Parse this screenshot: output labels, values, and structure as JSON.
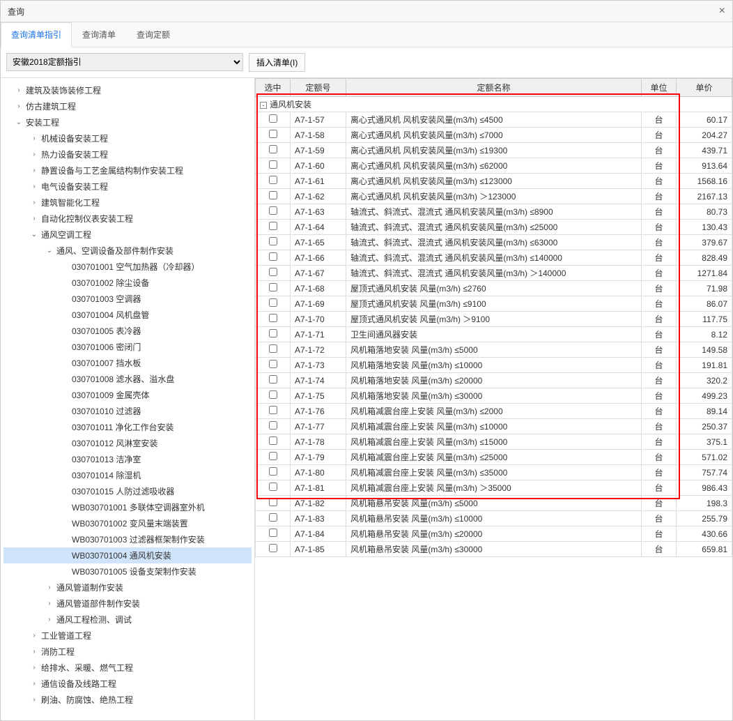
{
  "window": {
    "title": "查询"
  },
  "tabs": [
    {
      "label": "查询清单指引",
      "active": true
    },
    {
      "label": "查询清单",
      "active": false
    },
    {
      "label": "查询定额",
      "active": false
    }
  ],
  "dropdown": {
    "selected": "安徽2018定额指引"
  },
  "buttons": {
    "insert": "插入清单(I)"
  },
  "tree": [
    {
      "indent": 0,
      "arrow": ">",
      "label": "建筑及装饰装修工程"
    },
    {
      "indent": 0,
      "arrow": ">",
      "label": "仿古建筑工程"
    },
    {
      "indent": 0,
      "arrow": "v",
      "label": "安装工程"
    },
    {
      "indent": 1,
      "arrow": ">",
      "label": "机械设备安装工程"
    },
    {
      "indent": 1,
      "arrow": ">",
      "label": "热力设备安装工程"
    },
    {
      "indent": 1,
      "arrow": ">",
      "label": "静置设备与工艺金属结构制作安装工程"
    },
    {
      "indent": 1,
      "arrow": ">",
      "label": "电气设备安装工程"
    },
    {
      "indent": 1,
      "arrow": ">",
      "label": "建筑智能化工程"
    },
    {
      "indent": 1,
      "arrow": ">",
      "label": "自动化控制仪表安装工程"
    },
    {
      "indent": 1,
      "arrow": "v",
      "label": "通风空调工程"
    },
    {
      "indent": 2,
      "arrow": "v",
      "label": "通风、空调设备及部件制作安装"
    },
    {
      "indent": 3,
      "arrow": "",
      "label": "030701001  空气加热器（冷却器）"
    },
    {
      "indent": 3,
      "arrow": "",
      "label": "030701002  除尘设备"
    },
    {
      "indent": 3,
      "arrow": "",
      "label": "030701003  空调器"
    },
    {
      "indent": 3,
      "arrow": "",
      "label": "030701004  风机盘管"
    },
    {
      "indent": 3,
      "arrow": "",
      "label": "030701005  表冷器"
    },
    {
      "indent": 3,
      "arrow": "",
      "label": "030701006  密闭门"
    },
    {
      "indent": 3,
      "arrow": "",
      "label": "030701007  挡水板"
    },
    {
      "indent": 3,
      "arrow": "",
      "label": "030701008  滤水器、溢水盘"
    },
    {
      "indent": 3,
      "arrow": "",
      "label": "030701009  金属壳体"
    },
    {
      "indent": 3,
      "arrow": "",
      "label": "030701010  过滤器"
    },
    {
      "indent": 3,
      "arrow": "",
      "label": "030701011  净化工作台安装"
    },
    {
      "indent": 3,
      "arrow": "",
      "label": "030701012  风淋室安装"
    },
    {
      "indent": 3,
      "arrow": "",
      "label": "030701013  洁净室"
    },
    {
      "indent": 3,
      "arrow": "",
      "label": "030701014  除湿机"
    },
    {
      "indent": 3,
      "arrow": "",
      "label": "030701015  人防过滤吸收器"
    },
    {
      "indent": 3,
      "arrow": "",
      "label": "WB030701001  多联体空调器室外机"
    },
    {
      "indent": 3,
      "arrow": "",
      "label": "WB030701002  变风量末端装置"
    },
    {
      "indent": 3,
      "arrow": "",
      "label": "WB030701003  过滤器框架制作安装"
    },
    {
      "indent": 3,
      "arrow": "",
      "label": "WB030701004  通风机安装",
      "selected": true
    },
    {
      "indent": 3,
      "arrow": "",
      "label": "WB030701005  设备支架制作安装"
    },
    {
      "indent": 2,
      "arrow": ">",
      "label": "通风管道制作安装"
    },
    {
      "indent": 2,
      "arrow": ">",
      "label": "通风管道部件制作安装"
    },
    {
      "indent": 2,
      "arrow": ">",
      "label": "通风工程检测、调试"
    },
    {
      "indent": 1,
      "arrow": ">",
      "label": "工业管道工程"
    },
    {
      "indent": 1,
      "arrow": ">",
      "label": "消防工程"
    },
    {
      "indent": 1,
      "arrow": ">",
      "label": "给排水、采暖、燃气工程"
    },
    {
      "indent": 1,
      "arrow": ">",
      "label": "通信设备及线路工程"
    },
    {
      "indent": 1,
      "arrow": ">",
      "label": "刷油、防腐蚀、绝热工程"
    }
  ],
  "table": {
    "headers": {
      "sel": "选中",
      "code": "定额号",
      "name": "定额名称",
      "unit": "单位",
      "price": "单价"
    },
    "group": "通风机安装",
    "rows": [
      {
        "code": "A7-1-57",
        "name": "离心式通风机 风机安装风量(m3/h) ≤4500",
        "unit": "台",
        "price": "60.17"
      },
      {
        "code": "A7-1-58",
        "name": "离心式通风机 风机安装风量(m3/h) ≤7000",
        "unit": "台",
        "price": "204.27"
      },
      {
        "code": "A7-1-59",
        "name": "离心式通风机 风机安装风量(m3/h) ≤19300",
        "unit": "台",
        "price": "439.71"
      },
      {
        "code": "A7-1-60",
        "name": "离心式通风机 风机安装风量(m3/h) ≤62000",
        "unit": "台",
        "price": "913.64"
      },
      {
        "code": "A7-1-61",
        "name": "离心式通风机 风机安装风量(m3/h) ≤123000",
        "unit": "台",
        "price": "1568.16"
      },
      {
        "code": "A7-1-62",
        "name": "离心式通风机 风机安装风量(m3/h) ＞123000",
        "unit": "台",
        "price": "2167.13"
      },
      {
        "code": "A7-1-63",
        "name": "轴流式、斜流式、混流式 通风机安装风量(m3/h) ≤8900",
        "unit": "台",
        "price": "80.73"
      },
      {
        "code": "A7-1-64",
        "name": "轴流式、斜流式、混流式 通风机安装风量(m3/h) ≤25000",
        "unit": "台",
        "price": "130.43"
      },
      {
        "code": "A7-1-65",
        "name": "轴流式、斜流式、混流式 通风机安装风量(m3/h) ≤63000",
        "unit": "台",
        "price": "379.67"
      },
      {
        "code": "A7-1-66",
        "name": "轴流式、斜流式、混流式 通风机安装风量(m3/h) ≤140000",
        "unit": "台",
        "price": "828.49"
      },
      {
        "code": "A7-1-67",
        "name": "轴流式、斜流式、混流式 通风机安装风量(m3/h) ＞140000",
        "unit": "台",
        "price": "1271.84"
      },
      {
        "code": "A7-1-68",
        "name": "屋顶式通风机安装 风量(m3/h) ≤2760",
        "unit": "台",
        "price": "71.98"
      },
      {
        "code": "A7-1-69",
        "name": "屋顶式通风机安装 风量(m3/h) ≤9100",
        "unit": "台",
        "price": "86.07"
      },
      {
        "code": "A7-1-70",
        "name": "屋顶式通风机安装 风量(m3/h) ＞9100",
        "unit": "台",
        "price": "117.75"
      },
      {
        "code": "A7-1-71",
        "name": "卫生间通风器安装",
        "unit": "台",
        "price": "8.12"
      },
      {
        "code": "A7-1-72",
        "name": "风机箱落地安装 风量(m3/h) ≤5000",
        "unit": "台",
        "price": "149.58"
      },
      {
        "code": "A7-1-73",
        "name": "风机箱落地安装 风量(m3/h) ≤10000",
        "unit": "台",
        "price": "191.81"
      },
      {
        "code": "A7-1-74",
        "name": "风机箱落地安装 风量(m3/h) ≤20000",
        "unit": "台",
        "price": "320.2"
      },
      {
        "code": "A7-1-75",
        "name": "风机箱落地安装 风量(m3/h) ≤30000",
        "unit": "台",
        "price": "499.23"
      },
      {
        "code": "A7-1-76",
        "name": "风机箱减震台座上安装 风量(m3/h) ≤2000",
        "unit": "台",
        "price": "89.14"
      },
      {
        "code": "A7-1-77",
        "name": "风机箱减震台座上安装 风量(m3/h) ≤10000",
        "unit": "台",
        "price": "250.37"
      },
      {
        "code": "A7-1-78",
        "name": "风机箱减震台座上安装 风量(m3/h) ≤15000",
        "unit": "台",
        "price": "375.1"
      },
      {
        "code": "A7-1-79",
        "name": "风机箱减震台座上安装 风量(m3/h) ≤25000",
        "unit": "台",
        "price": "571.02"
      },
      {
        "code": "A7-1-80",
        "name": "风机箱减震台座上安装 风量(m3/h) ≤35000",
        "unit": "台",
        "price": "757.74"
      },
      {
        "code": "A7-1-81",
        "name": "风机箱减震台座上安装 风量(m3/h) ＞35000",
        "unit": "台",
        "price": "986.43"
      },
      {
        "code": "A7-1-82",
        "name": "风机箱悬吊安装 风量(m3/h) ≤5000",
        "unit": "台",
        "price": "198.3"
      },
      {
        "code": "A7-1-83",
        "name": "风机箱悬吊安装 风量(m3/h) ≤10000",
        "unit": "台",
        "price": "255.79"
      },
      {
        "code": "A7-1-84",
        "name": "风机箱悬吊安装 风量(m3/h) ≤20000",
        "unit": "台",
        "price": "430.66"
      },
      {
        "code": "A7-1-85",
        "name": "风机箱悬吊安装 风量(m3/h) ≤30000",
        "unit": "台",
        "price": "659.81"
      }
    ]
  }
}
